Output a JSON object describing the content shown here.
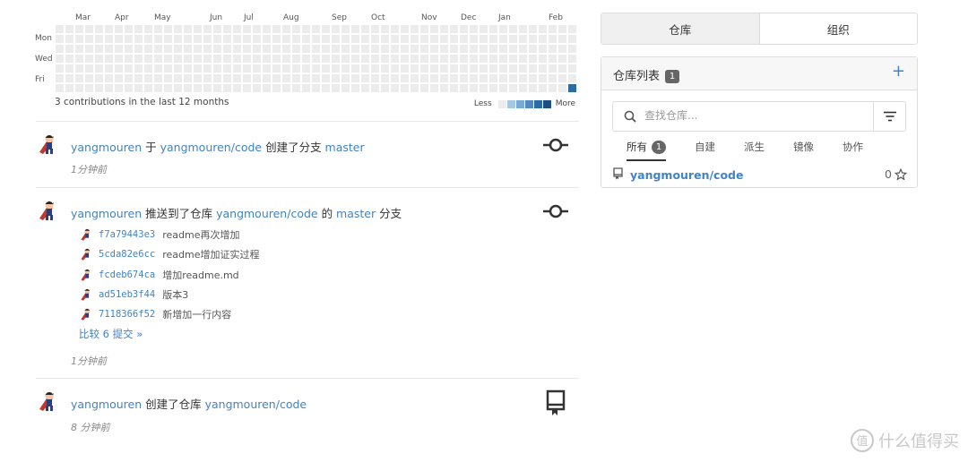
{
  "heatmap": {
    "months": [
      "Mar",
      "Apr",
      "May",
      "Jun",
      "Jul",
      "Aug",
      "Sep",
      "Oct",
      "Nov",
      "Dec",
      "Jan",
      "Feb"
    ],
    "days": [
      "Mon",
      "Wed",
      "Fri"
    ],
    "summary": "3 contributions in the last 12 months",
    "legend_less": "Less",
    "legend_more": "More",
    "legend_colors": [
      "#ececec",
      "#a6c6e6",
      "#7aa9d6",
      "#5389bf",
      "#2d6ca2",
      "#1f4f80"
    ],
    "weeks": 53,
    "active_cell": {
      "week": 52,
      "day": 6,
      "level": 4
    }
  },
  "feed": [
    {
      "user": "yangmouren",
      "parts": [
        {
          "text": "yangmouren",
          "link": true
        },
        {
          "text": " 于 ",
          "link": false
        },
        {
          "text": "yangmouren/code",
          "link": true
        },
        {
          "text": " 创建了分支 ",
          "link": false
        },
        {
          "text": "master",
          "link": true
        }
      ],
      "time": "1分钟前",
      "icon": "commit-icon"
    },
    {
      "user": "yangmouren",
      "parts": [
        {
          "text": "yangmouren",
          "link": true
        },
        {
          "text": " 推送到了仓库 ",
          "link": false
        },
        {
          "text": "yangmouren/code",
          "link": true
        },
        {
          "text": " 的 ",
          "link": false
        },
        {
          "text": "master",
          "link": true
        },
        {
          "text": " 分支",
          "link": false
        }
      ],
      "commits": [
        {
          "sha": "f7a79443e3",
          "message": "readme再次增加"
        },
        {
          "sha": "5cda82e6cc",
          "message": "readme增加证实过程"
        },
        {
          "sha": "fcdeb674ca",
          "message": "增加readme.md"
        },
        {
          "sha": "ad51eb3f44",
          "message": "版本3"
        },
        {
          "sha": "7118366f52",
          "message": "新增加一行内容"
        }
      ],
      "compare": "比较 6 提交 »",
      "time": "1分钟前",
      "icon": "commit-icon"
    },
    {
      "user": "yangmouren",
      "parts": [
        {
          "text": "yangmouren",
          "link": true
        },
        {
          "text": " 创建了仓库 ",
          "link": false
        },
        {
          "text": "yangmouren/code",
          "link": true
        }
      ],
      "time": "8 分钟前",
      "icon": "repo-icon"
    }
  ],
  "tabs": [
    "仓库",
    "组织"
  ],
  "repo_panel": {
    "title": "仓库列表",
    "count": "1",
    "add": "+",
    "search_placeholder": "查找仓库...",
    "filters": [
      {
        "label": "所有",
        "badge": "1"
      },
      {
        "label": "自建"
      },
      {
        "label": "派生"
      },
      {
        "label": "镜像"
      },
      {
        "label": "协作"
      }
    ],
    "repos": [
      {
        "name": "yangmouren/code",
        "stars": "0"
      }
    ]
  },
  "watermark": "什么值得买",
  "colors": {
    "link": "#4183c4",
    "heat_active": "#2d6ca2",
    "heat_empty": "#ececec"
  }
}
